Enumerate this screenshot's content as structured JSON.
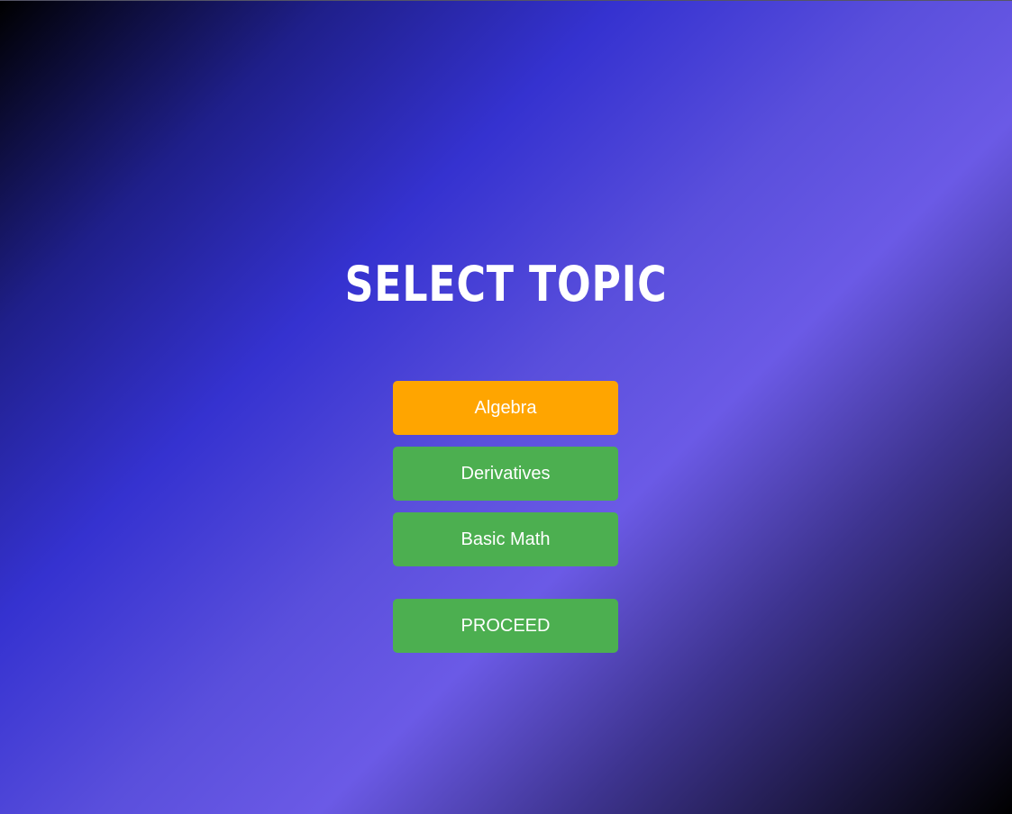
{
  "title": "SELECT TOPIC",
  "topics": [
    {
      "label": "Algebra",
      "selected": true,
      "color": "#ffa500"
    },
    {
      "label": "Derivatives",
      "selected": false,
      "color": "#4caf50"
    },
    {
      "label": "Basic Math",
      "selected": false,
      "color": "#4caf50"
    }
  ],
  "proceed_label": "PROCEED",
  "colors": {
    "selected": "#ffa500",
    "default": "#4caf50",
    "text": "#ffffff"
  }
}
